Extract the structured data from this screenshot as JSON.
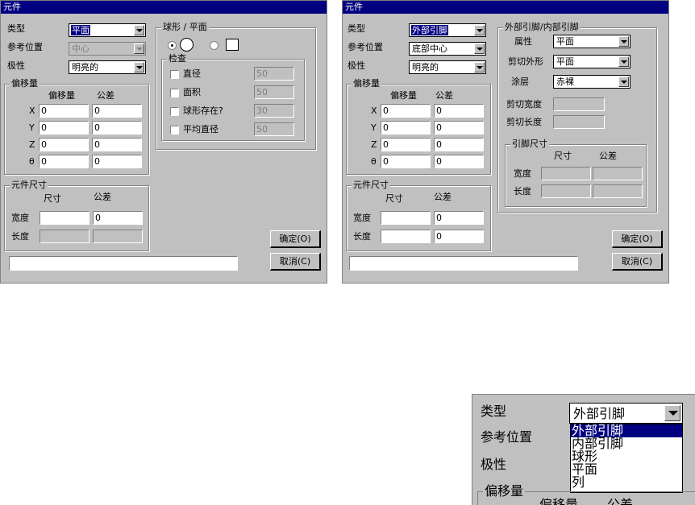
{
  "left": {
    "title": "元件",
    "fields": {
      "type_label": "类型",
      "type_value": "平面",
      "ref_label": "参考位置",
      "ref_value": "中心",
      "pol_label": "极性",
      "pol_value": "明亮的"
    },
    "offset": {
      "title": "偏移量",
      "col_offset": "偏移量",
      "col_tol": "公差",
      "rows": [
        {
          "label": "X",
          "offset": "0",
          "tol": "0"
        },
        {
          "label": "Y",
          "offset": "0",
          "tol": "0"
        },
        {
          "label": "Z",
          "offset": "0",
          "tol": "0"
        },
        {
          "label": "θ",
          "offset": "0",
          "tol": "0"
        }
      ]
    },
    "sphere": {
      "title": "球形 / 平面",
      "check_title": "检查",
      "checks": [
        {
          "label": "直径",
          "value": "50"
        },
        {
          "label": "面积",
          "value": "50"
        },
        {
          "label": "球形存在?",
          "value": "30"
        },
        {
          "label": "平均直径",
          "value": "50"
        }
      ]
    },
    "size": {
      "title": "元件尺寸",
      "col_size": "尺寸",
      "col_tol": "公差",
      "width_label": "宽度",
      "width_tol": "0",
      "length_label": "长度"
    },
    "ok": "确定(O)",
    "cancel": "取消(C)"
  },
  "right": {
    "title": "元件",
    "fields": {
      "type_label": "类型",
      "type_value": "外部引脚",
      "ref_label": "参考位置",
      "ref_value": "底部中心",
      "pol_label": "极性",
      "pol_value": "明亮的"
    },
    "offset": {
      "title": "偏移量",
      "col_offset": "偏移量",
      "col_tol": "公差",
      "rows": [
        {
          "label": "X",
          "offset": "0",
          "tol": "0"
        },
        {
          "label": "Y",
          "offset": "0",
          "tol": "0"
        },
        {
          "label": "Z",
          "offset": "0",
          "tol": "0"
        },
        {
          "label": "θ",
          "offset": "0",
          "tol": "0"
        }
      ]
    },
    "size": {
      "title": "元件尺寸",
      "col_size": "尺寸",
      "col_tol": "公差",
      "width_label": "宽度",
      "width_tol": "0",
      "length_label": "长度",
      "length_tol": "0"
    },
    "pin": {
      "title": "外部引脚/内部引脚",
      "attr_label": "属性",
      "attr_value": "平面",
      "cut_label": "剪切外形",
      "cut_value": "平面",
      "coat_label": "涂层",
      "coat_value": "赤裸",
      "cut_width": "剪切宽度",
      "cut_length": "剪切长度",
      "pinsize": {
        "title": "引脚尺寸",
        "col_size": "尺寸",
        "col_tol": "公差",
        "width": "宽度",
        "length": "长度"
      }
    },
    "ok": "确定(O)",
    "cancel": "取消(C)"
  },
  "zoom": {
    "type_label": "类型",
    "type_value": "外部引脚",
    "ref_label": "参考位置",
    "pol_label": "极性",
    "offset_label": "偏移量",
    "col_offset": "偏移量",
    "col_tol": "公差",
    "options": [
      "外部引脚",
      "内部引脚",
      "球形",
      "平面",
      "列"
    ]
  }
}
